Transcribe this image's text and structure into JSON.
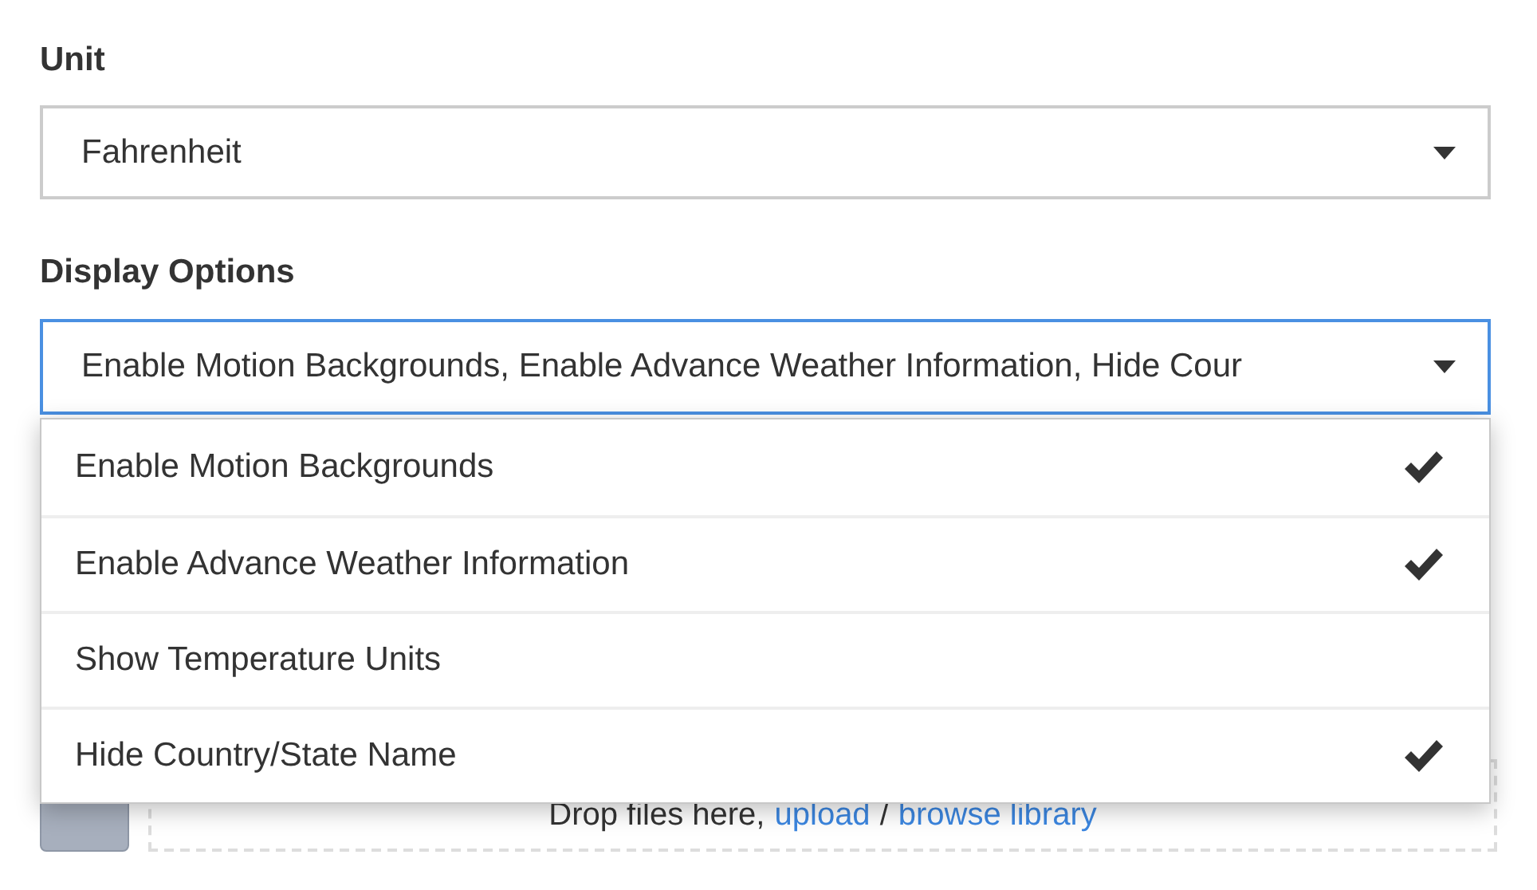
{
  "unit": {
    "label": "Unit",
    "value": "Fahrenheit"
  },
  "display_options": {
    "label": "Display Options",
    "value": "Enable Motion Backgrounds, Enable Advance Weather Information, Hide Cour",
    "focused": true,
    "options": [
      {
        "label": "Enable Motion Backgrounds",
        "checked": true
      },
      {
        "label": "Enable Advance Weather Information",
        "checked": true
      },
      {
        "label": "Show Temperature Units",
        "checked": false
      },
      {
        "label": "Hide Country/State Name",
        "checked": true
      }
    ]
  },
  "dropzone": {
    "text": "Drop files here,",
    "upload_link": "upload",
    "separator": "/",
    "browse_link": "browse library"
  }
}
